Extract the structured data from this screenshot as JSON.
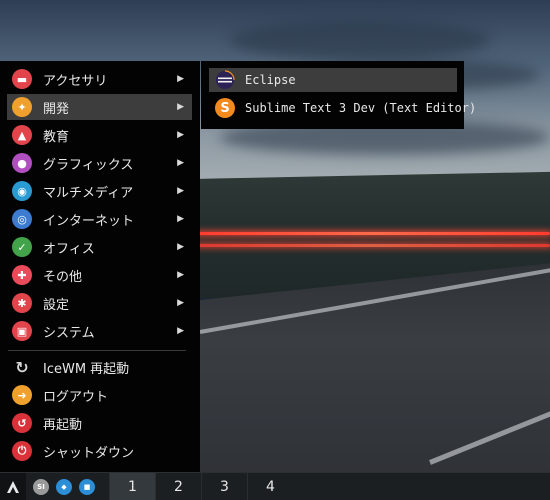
{
  "main_menu": {
    "items": [
      {
        "label": "アクセサリ",
        "has_submenu": true,
        "icon": "accessories-icon",
        "color": "#e2444b"
      },
      {
        "label": "開発",
        "has_submenu": true,
        "icon": "development-icon",
        "color": "#f0a02c",
        "active": true
      },
      {
        "label": "教育",
        "has_submenu": true,
        "icon": "education-icon",
        "color": "#e2444b"
      },
      {
        "label": "グラフィックス",
        "has_submenu": true,
        "icon": "graphics-icon",
        "color": "#b24fc0"
      },
      {
        "label": "マルチメディア",
        "has_submenu": true,
        "icon": "multimedia-icon",
        "color": "#2a9bd2"
      },
      {
        "label": "インターネット",
        "has_submenu": true,
        "icon": "internet-icon",
        "color": "#3c7bd0"
      },
      {
        "label": "オフィス",
        "has_submenu": true,
        "icon": "office-icon",
        "color": "#43a34a"
      },
      {
        "label": "その他",
        "has_submenu": true,
        "icon": "other-icon",
        "color": "#e94b5a"
      },
      {
        "label": "設定",
        "has_submenu": true,
        "icon": "settings-icon",
        "color": "#e2444b"
      },
      {
        "label": "システム",
        "has_submenu": true,
        "icon": "system-icon",
        "color": "#e2444b"
      },
      {
        "label": "IceWM 再起動",
        "has_submenu": false,
        "icon": "restart-wm-icon",
        "color": "#d6d6d6"
      },
      {
        "label": "ログアウト",
        "has_submenu": false,
        "icon": "logout-icon",
        "color": "#f0a02c"
      },
      {
        "label": "再起動",
        "has_submenu": false,
        "icon": "reboot-icon",
        "color": "#d9323a"
      },
      {
        "label": "シャットダウン",
        "has_submenu": false,
        "icon": "shutdown-icon",
        "color": "#d9323a"
      }
    ],
    "arrow_glyph": "▶"
  },
  "submenu": {
    "items": [
      {
        "label": "Eclipse",
        "icon": "eclipse-icon",
        "color": "#2c2255",
        "active": true
      },
      {
        "label": "Sublime Text 3 Dev (Text Editor)",
        "icon": "sublime-text-icon",
        "color": "#f28a1e"
      }
    ]
  },
  "taskbar": {
    "tray": [
      {
        "icon": "system-monitor-icon",
        "color": "#9a9a9a",
        "text": "SI"
      },
      {
        "icon": "network-icon",
        "color": "#2b8ed6",
        "text": "◆"
      },
      {
        "icon": "files-icon",
        "color": "#2b8ed6",
        "text": "■"
      }
    ],
    "workspaces": [
      "1",
      "2",
      "3",
      "4"
    ],
    "active_workspace": "1"
  }
}
